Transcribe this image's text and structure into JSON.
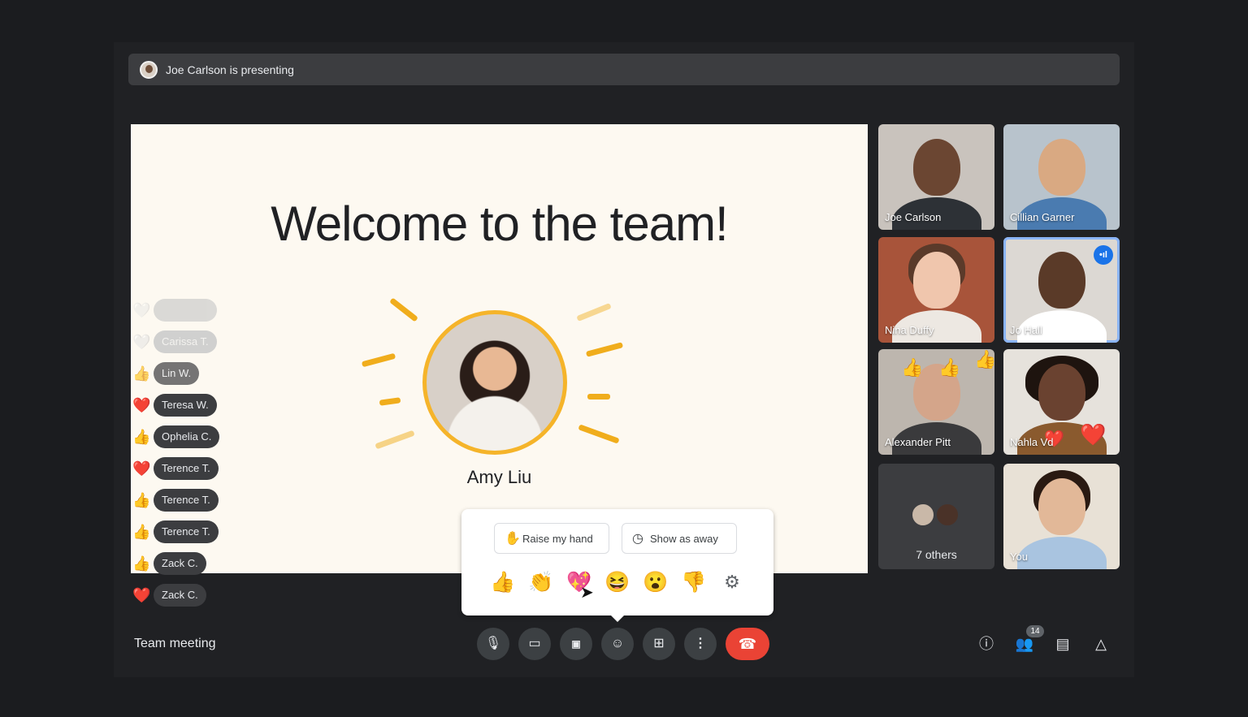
{
  "presenting": {
    "text": "Joe Carlson is presenting"
  },
  "slide": {
    "title": "Welcome to the team!",
    "person_name": "Amy Liu"
  },
  "reactions": [
    {
      "emoji": "🤍",
      "name": ""
    },
    {
      "emoji": "🤍",
      "name": "Carissa T."
    },
    {
      "emoji": "👍",
      "name": "Lin W."
    },
    {
      "emoji": "❤️",
      "name": "Teresa W."
    },
    {
      "emoji": "👍",
      "name": "Ophelia C."
    },
    {
      "emoji": "❤️",
      "name": "Terence T."
    },
    {
      "emoji": "👍",
      "name": "Terence T."
    },
    {
      "emoji": "👍",
      "name": "Terence T."
    },
    {
      "emoji": "👍",
      "name": "Zack C."
    },
    {
      "emoji": "❤️",
      "name": "Zack C."
    }
  ],
  "tiles": {
    "joe": "Joe Carlson",
    "cillian": "Cillian Garner",
    "nina": "Nina Duffy",
    "jo": "Jo Hall",
    "alexander": "Alexander Pitt",
    "nahla": "Nahla Vd",
    "others": "7 others",
    "you": "You"
  },
  "popup": {
    "raise_hand": "Raise my hand",
    "show_away": "Show as away",
    "emojis": [
      "👍",
      "👏",
      "💖",
      "😆",
      "😮",
      "👎"
    ]
  },
  "bottom": {
    "meeting_title": "Team meeting",
    "participants_count": "14"
  },
  "icons": {
    "mic": "mic-icon",
    "camera": "camera-icon",
    "captions": "captions-icon",
    "reactions": "reactions-icon",
    "present": "present-icon",
    "more": "more-icon",
    "end_call": "phone-icon",
    "info": "info-icon",
    "people": "people-icon",
    "chat": "chat-icon",
    "activities": "activities-icon"
  },
  "colors": {
    "end_call": "#ea4335",
    "accent_yellow": "#f5b42a",
    "active_outline": "#8ab4f8"
  }
}
